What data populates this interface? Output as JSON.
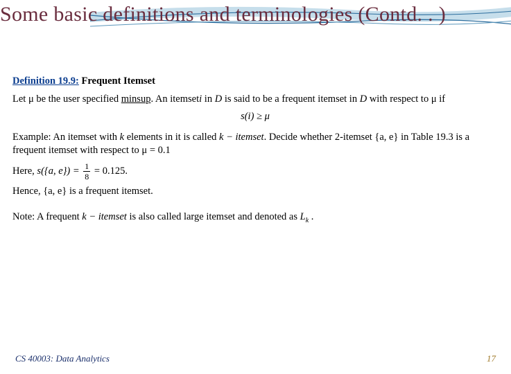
{
  "title": "Some basic definitions and terminologies (Contd. . )",
  "definition": {
    "label": "Definition 19.9:",
    "name": "Frequent Itemset",
    "line1_a": "Let μ be the user specified ",
    "line1_minsup": "minsup",
    "line1_b": ". An itemset",
    "line1_c": " in ",
    "line1_d": " is said to be a frequent itemset in ",
    "line1_e": " with respect to μ if",
    "i": "i",
    "D": "D",
    "formula": "s(i)  ≥  μ"
  },
  "example": {
    "prefix": "Example: An itemset with ",
    "k": "k",
    "mid1": " elements in it is called ",
    "kitem": "k − itemset",
    "mid2": ". Decide whether 2-itemset ",
    "set": "{a, e}",
    "mid3": " in Table 19.3 is a frequent itemset with respect to μ = 0.1",
    "here": "Here, ",
    "sae": "s({a, e}) = ",
    "num": "1",
    "den": "8",
    "eqv": " = 0.125.",
    "hence": "Hence, ",
    "set2": "{a, e}",
    "hence2": " is a frequent itemset."
  },
  "note": {
    "a": "Note: A frequent ",
    "kitem": "k − itemset",
    "b": " is also called large itemset and denoted as ",
    "L": "L",
    "ksub": "k",
    "dot": " ."
  },
  "footer": {
    "left": "CS 40003: Data Analytics",
    "right": "17"
  }
}
